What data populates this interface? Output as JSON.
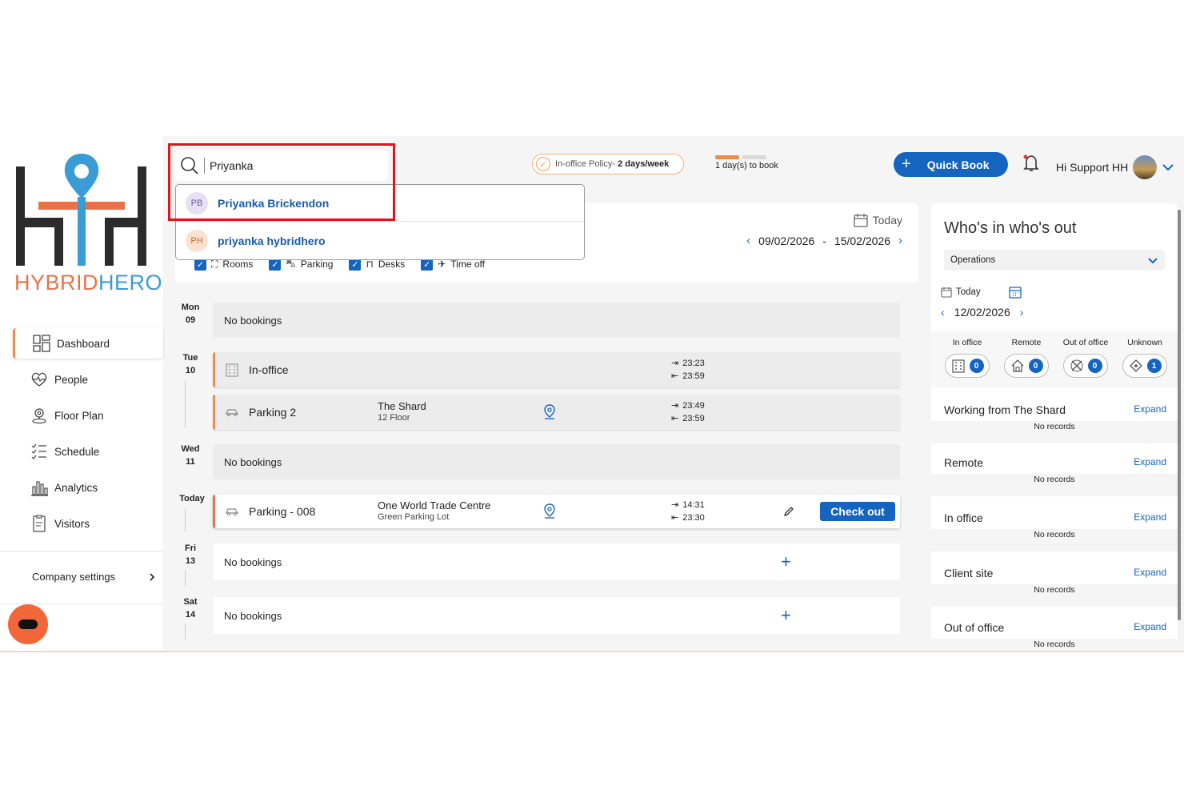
{
  "brand": {
    "name_part1": "HYBRID",
    "name_part2": "HERO",
    "colors": {
      "orange": "#e8734a",
      "blue": "#3a9bd5",
      "primary": "#1565c0"
    }
  },
  "sidebar": {
    "items": [
      {
        "label": "Dashboard",
        "icon": "dashboard-icon"
      },
      {
        "label": "People",
        "icon": "people-icon"
      },
      {
        "label": "Floor Plan",
        "icon": "floor-plan-icon"
      },
      {
        "label": "Schedule",
        "icon": "schedule-icon"
      },
      {
        "label": "Analytics",
        "icon": "analytics-icon"
      },
      {
        "label": "Visitors",
        "icon": "visitors-icon"
      }
    ],
    "company_settings": "Company settings"
  },
  "search": {
    "value": "Priyanka",
    "results": [
      {
        "initials": "PB",
        "name": "Priyanka Brickendon"
      },
      {
        "initials": "PH",
        "name": "priyanka hybridhero"
      }
    ]
  },
  "policy": {
    "label": "In-office Policy-",
    "value": "2 days/week"
  },
  "booking_progress": {
    "label": "1 day(s) to book",
    "filled_fraction": 0.5
  },
  "header": {
    "quick_book": "Quick Book",
    "greeting": "Hi Support HH"
  },
  "week": {
    "today_label": "Today",
    "start": "09/02/2026",
    "separator": "-",
    "end": "15/02/2026",
    "filters": [
      "Rooms",
      "Parking",
      "Desks",
      "Time off"
    ]
  },
  "schedule": {
    "days": [
      {
        "dow": "Mon",
        "dom": "09"
      },
      {
        "dow": "Tue",
        "dom": "10"
      },
      {
        "dow": "Wed",
        "dom": "11"
      },
      {
        "dow": "Today",
        "dom": ""
      },
      {
        "dow": "Fri",
        "dom": "13"
      },
      {
        "dow": "Sat",
        "dom": "14"
      }
    ],
    "no_bookings": "No bookings",
    "tue_inoffice": {
      "title": "In-office",
      "in": "23:23",
      "out": "23:59"
    },
    "tue_parking": {
      "title": "Parking 2",
      "location": "The Shard",
      "sublocation": "12 Floor",
      "in": "23:49",
      "out": "23:59"
    },
    "today_parking": {
      "title": "Parking - 008",
      "location": "One World Trade Centre",
      "sublocation": "Green Parking Lot",
      "in": "14:31",
      "out": "23:30",
      "action": "Check out"
    }
  },
  "whos_in": {
    "title": "Who's in who's out",
    "team": "Operations",
    "today_label": "Today",
    "date": "12/02/2026",
    "statuses": [
      {
        "label": "In office",
        "count": "0",
        "icon": "building-icon"
      },
      {
        "label": "Remote",
        "count": "0",
        "icon": "home-icon"
      },
      {
        "label": "Out of office",
        "count": "0",
        "icon": "out-of-office-icon"
      },
      {
        "label": "Unknown",
        "count": "1",
        "icon": "unknown-icon"
      }
    ],
    "expand_label": "Expand",
    "no_records": "No records",
    "sections": [
      "Working from The Shard",
      "Remote",
      "In office",
      "Client site",
      "Out of office"
    ]
  }
}
